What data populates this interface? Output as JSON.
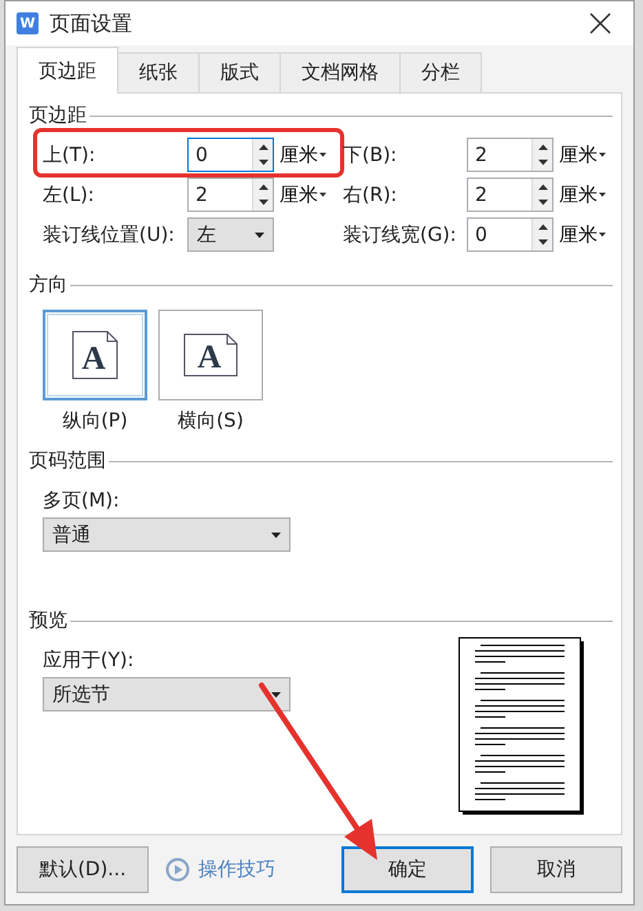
{
  "window": {
    "app_icon_letter": "W",
    "title": "页面设置"
  },
  "tabs": [
    {
      "label": "页边距",
      "selected": true
    },
    {
      "label": "纸张",
      "selected": false
    },
    {
      "label": "版式",
      "selected": false
    },
    {
      "label": "文档网格",
      "selected": false
    },
    {
      "label": "分栏",
      "selected": false
    }
  ],
  "margins": {
    "title": "页边距",
    "fields": [
      {
        "label": "上(T):",
        "value": "0",
        "unit": "厘米",
        "focused": true
      },
      {
        "label": "下(B):",
        "value": "2",
        "unit": "厘米",
        "focused": false
      },
      {
        "label": "左(L):",
        "value": "2",
        "unit": "厘米",
        "focused": false
      },
      {
        "label": "右(R):",
        "value": "2",
        "unit": "厘米",
        "focused": false
      }
    ],
    "gutter_position": {
      "label": "装订线位置(U):",
      "value": "左"
    },
    "gutter_width": {
      "label": "装订线宽(G):",
      "value": "0",
      "unit": "厘米"
    }
  },
  "orientation": {
    "title": "方向",
    "options": [
      {
        "label": "纵向(P)",
        "glyph": "A",
        "selected": true
      },
      {
        "label": "横向(S)",
        "glyph": "A",
        "selected": false
      }
    ]
  },
  "page_range": {
    "title": "页码范围",
    "label": "多页(M):",
    "value": "普通"
  },
  "preview": {
    "title": "预览",
    "label": "应用于(Y):",
    "value": "所选节"
  },
  "buttons": [
    {
      "label": "默认(D)...",
      "kind": "button",
      "focused": false
    },
    {
      "label": "操作技巧",
      "kind": "link",
      "focused": false
    },
    {
      "label": "确定",
      "kind": "button",
      "focused": true
    },
    {
      "label": "取消",
      "kind": "button",
      "focused": false
    }
  ]
}
